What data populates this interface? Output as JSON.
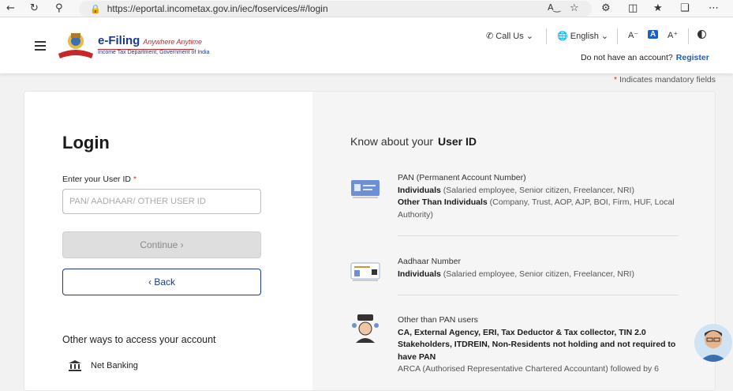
{
  "browser": {
    "url": "https://eportal.incometax.gov.in/iec/foservices/#/login"
  },
  "header": {
    "logo_title": "e-Filing",
    "logo_tagline": "Anywhere Anytime",
    "logo_subtitle": "Income Tax Department, Government of India",
    "call_us": "Call Us",
    "language": "English",
    "font_small": "A⁻",
    "font_normal": "A",
    "font_large": "A⁺",
    "no_account": "Do not have an account?",
    "register": "Register"
  },
  "mandatory_note": "Indicates mandatory fields",
  "login": {
    "title": "Login",
    "user_id_label": "Enter your User ID",
    "user_id_placeholder": "PAN/ AADHAAR/ OTHER USER ID",
    "continue_label": "Continue ›",
    "back_label": "‹ Back",
    "other_ways": "Other ways to access your account",
    "net_banking": "Net Banking"
  },
  "know": {
    "prefix": "Know about your",
    "highlight": "User ID",
    "items": [
      {
        "title": "PAN (Permanent Account Number)",
        "l1_bold": "Individuals",
        "l1_rest": " (Salaried employee, Senior citizen, Freelancer, NRI)",
        "l2_bold": "Other Than Individuals",
        "l2_rest": " (Company, Trust, AOP, AJP, BOI, Firm, HUF, Local Authority)"
      },
      {
        "title": "Aadhaar Number",
        "l1_bold": "Individuals",
        "l1_rest": " (Salaried employee, Senior citizen, Freelancer, NRI)"
      },
      {
        "title": "Other than PAN users",
        "l1_bold": "CA, External Agency, ERI, Tax Deductor & Tax collector, TIN 2.0 Stakeholders, ITDREIN, Non-Residents not holding and not required to have PAN",
        "l2_rest": "ARCA (Authorised Representative Chartered Accountant) followed by 6"
      }
    ]
  }
}
